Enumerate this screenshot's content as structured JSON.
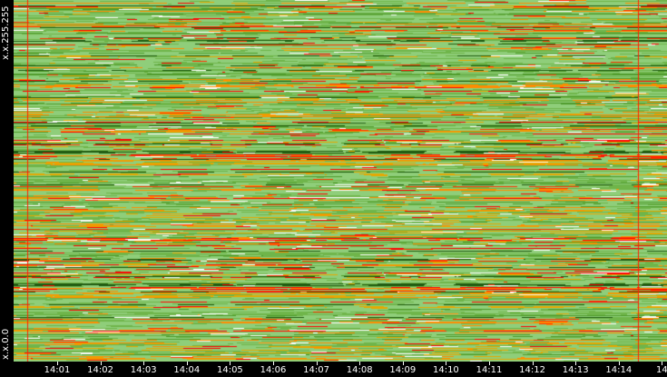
{
  "chart_data": {
    "type": "heatmap",
    "title": "",
    "xlabel": "",
    "ylabel": "",
    "y_labels": {
      "top": "x.x.255.255",
      "bottom": "x.x.0.0"
    },
    "x_ticks": [
      "14:01",
      "14:02",
      "14:03",
      "14:04",
      "14:05",
      "14:06",
      "14:07",
      "14:08",
      "14:09",
      "14:10",
      "14:11",
      "14:12",
      "14:13",
      "14:14",
      "14"
    ],
    "x_range": [
      "14:00",
      "14:15"
    ],
    "color_scale": [
      "#8fce7a",
      "#6fb54a",
      "#4e9a2a",
      "#1f5a10",
      "#ffffff",
      "#e6a800",
      "#ff8c00",
      "#ff3300",
      "#ff0000"
    ],
    "grid": false
  }
}
